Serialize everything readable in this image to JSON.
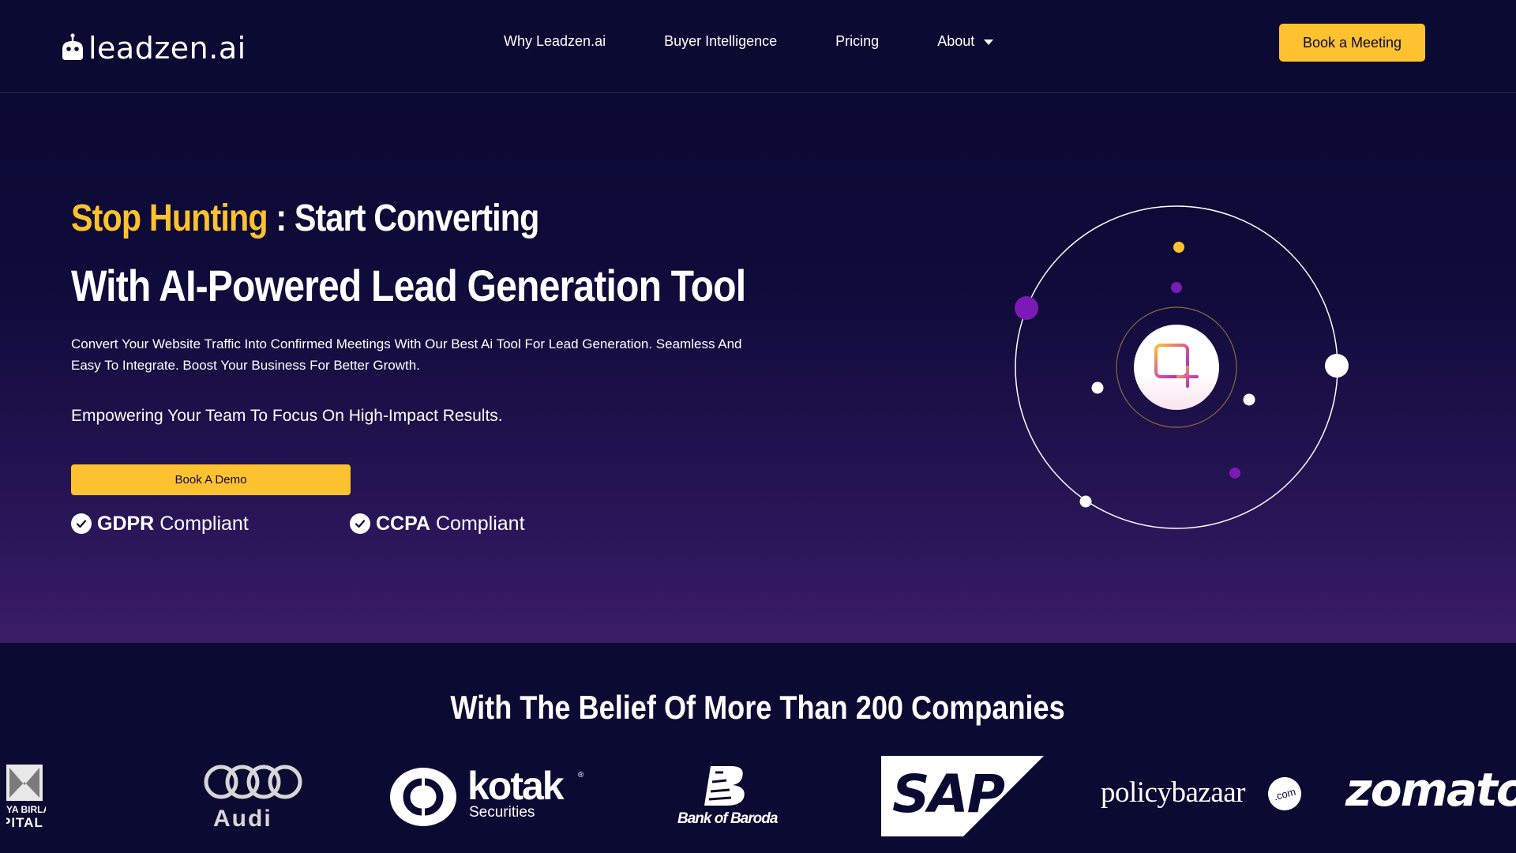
{
  "brand": {
    "name": "leadzen.ai"
  },
  "nav": {
    "items": [
      {
        "label": "Why Leadzen.ai"
      },
      {
        "label": "Buyer Intelligence"
      },
      {
        "label": "Pricing"
      },
      {
        "label": "About",
        "has_dropdown": true
      }
    ],
    "cta_label": "Book a Meeting"
  },
  "hero": {
    "headline_accent": "Stop Hunting",
    "headline_rest": " : Start Converting",
    "headline_2": "With AI-Powered Lead Generation Tool",
    "lead_line_1": "Convert Your Website Traffic Into Confirmed Meetings With Our Best Ai Tool For Lead Generation. Seamless And",
    "lead_line_2": "Easy To Integrate. Boost Your Business For Better Growth.",
    "subheading": "Empowering Your Team To Focus On High-Impact Results.",
    "cta_label": "Book A Demo",
    "compliance": [
      {
        "strong": "GDPR",
        "light": " Compliant"
      },
      {
        "strong": "CCPA",
        "light": " Compliant"
      }
    ]
  },
  "logos": {
    "title": "With The Belief Of More Than 200 Companies",
    "items": [
      {
        "name": "aditya-birla-capital",
        "text_1": "YA BIRLA",
        "text_2": "PITAL"
      },
      {
        "name": "audi",
        "text": "Audi"
      },
      {
        "name": "kotak-securities",
        "text": "kotak",
        "sub": "Securities",
        "reg": "®"
      },
      {
        "name": "bank-of-baroda",
        "text": "Bank of Baroda"
      },
      {
        "name": "sap",
        "text": "SAP"
      },
      {
        "name": "policybazaar",
        "text": "policybazaar",
        "badge": ".com"
      },
      {
        "name": "zomato",
        "text": "zomato"
      }
    ]
  },
  "colors": {
    "background": "#0b0a33",
    "accent_yellow": "#fec12f",
    "purple": "#7a1bb5",
    "gradient_bottom": "#3b1d66"
  },
  "icons": [
    "robot-logo-icon",
    "caret-down-icon",
    "check-circle-icon",
    "add-frame-icon"
  ]
}
